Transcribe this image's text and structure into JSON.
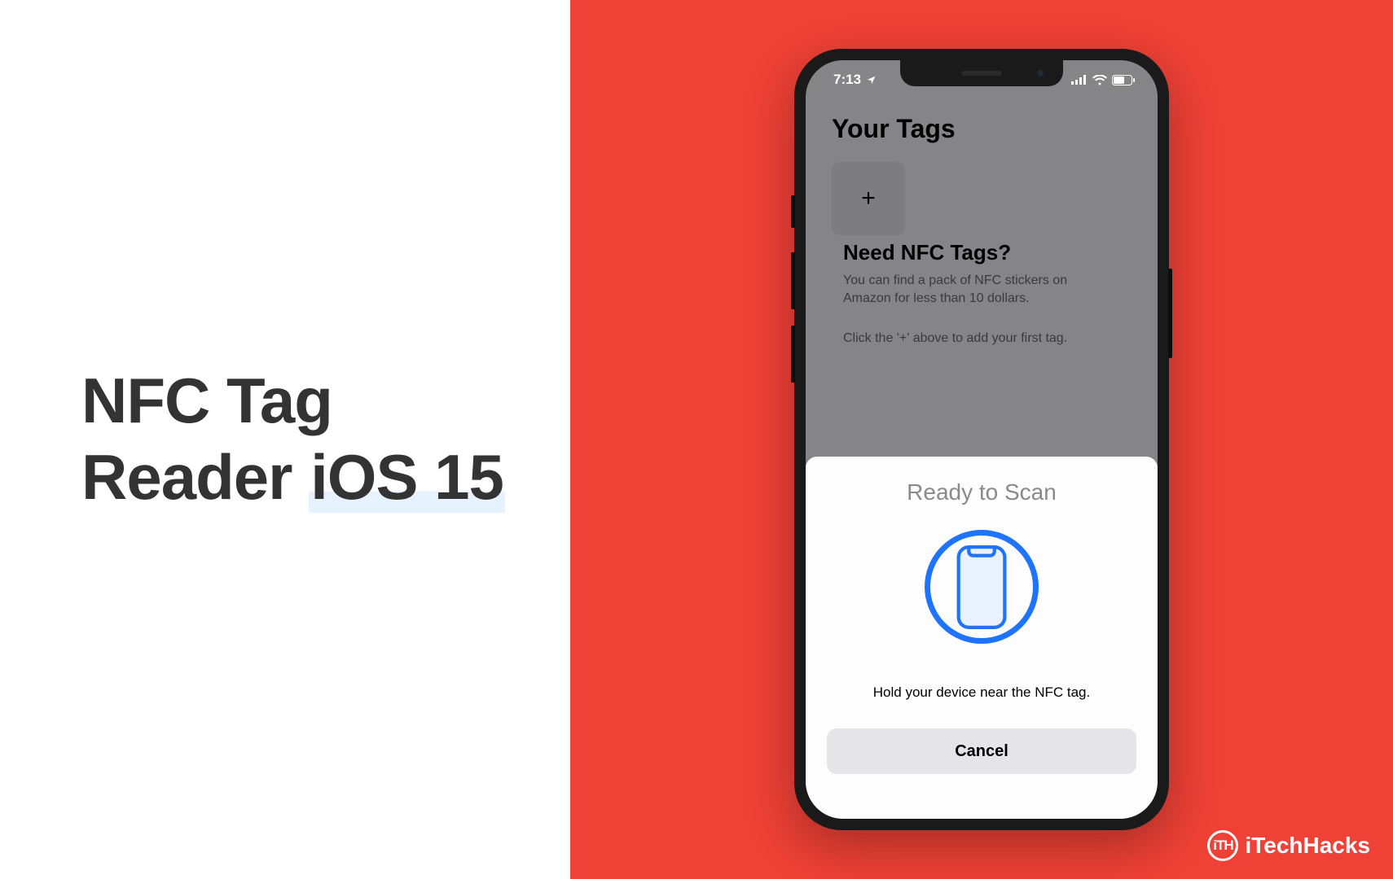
{
  "title": {
    "line1": "NFC Tag",
    "line2_a": "Reader ",
    "line2_b": "iOS 15"
  },
  "status": {
    "time": "7:13"
  },
  "app": {
    "heading": "Your Tags",
    "add_glyph": "+",
    "need_heading": "Need NFC Tags?",
    "need_desc": "You can find a pack of NFC stickers on Amazon for less than 10 dollars.",
    "add_hint": "Click the '+' above to add your first tag."
  },
  "sheet": {
    "title": "Ready to Scan",
    "instruction": "Hold your device near the NFC tag.",
    "cancel": "Cancel"
  },
  "watermark": {
    "badge": "iTH",
    "text": "iTechHacks"
  }
}
